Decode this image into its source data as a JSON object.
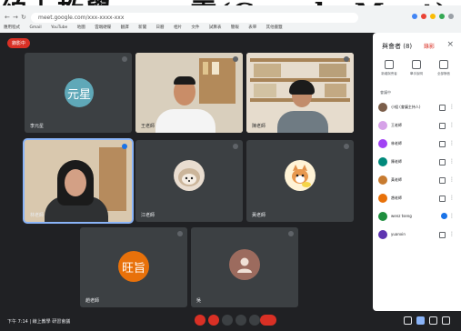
{
  "caption": "線上教學 —— 雲(Google Meet)",
  "browser": {
    "url": "meet.google.com/xxx-xxxx-xxx",
    "bookmarks": [
      "應用程式",
      "Gmail",
      "YouTube",
      "地圖",
      "雲端硬碟",
      "翻譯",
      "新聞",
      "日曆",
      "相片",
      "文件",
      "試算表",
      "簡報",
      "表單",
      "其他書籤"
    ]
  },
  "meeting": {
    "recording_label": "錄影中",
    "time_and_title": "下午 7:14  |  線上教學 研習會議",
    "tiles": [
      {
        "id": "yuanxing",
        "label": "元星",
        "name": "李元星",
        "color": "#5fa8b8"
      },
      {
        "id": "man_glasses",
        "name": "王老師"
      },
      {
        "id": "bookshelf_woman",
        "name": "陳老師"
      },
      {
        "id": "woman_glasses",
        "name": "林老師"
      },
      {
        "id": "hedgehog",
        "name": "江老師"
      },
      {
        "id": "cat",
        "name": "黃老師"
      },
      {
        "id": "wangzhi",
        "label": "旺旨",
        "name": "趙老師",
        "color": "#e8710a"
      },
      {
        "id": "default_user",
        "name": "吳"
      }
    ]
  },
  "panel": {
    "title": "與會者 (8)",
    "tag": "錄影",
    "actions": [
      "新增與會者",
      "舉手說明",
      "全部靜音"
    ],
    "section": "會議中",
    "people": [
      {
        "name": "小組 (會議主持人)",
        "color": "#7b5e4a"
      },
      {
        "name": "王老師",
        "color": "#d6a2e8"
      },
      {
        "name": "林老師",
        "color": "#a142f4"
      },
      {
        "name": "陳老師",
        "color": "#00897b"
      },
      {
        "name": "黃老師",
        "color": "#c77b30"
      },
      {
        "name": "趙老師",
        "color": "#e8710a"
      },
      {
        "name": "wenz tseng",
        "color": "#1e8e3e",
        "active": true
      },
      {
        "name": "yuanxin",
        "color": "#5e35b1"
      }
    ]
  },
  "controls": {
    "center_colors": [
      "#d93025",
      "#d93025",
      "#3c4043",
      "#3c4043",
      "#3c4043",
      "#d93025"
    ]
  }
}
